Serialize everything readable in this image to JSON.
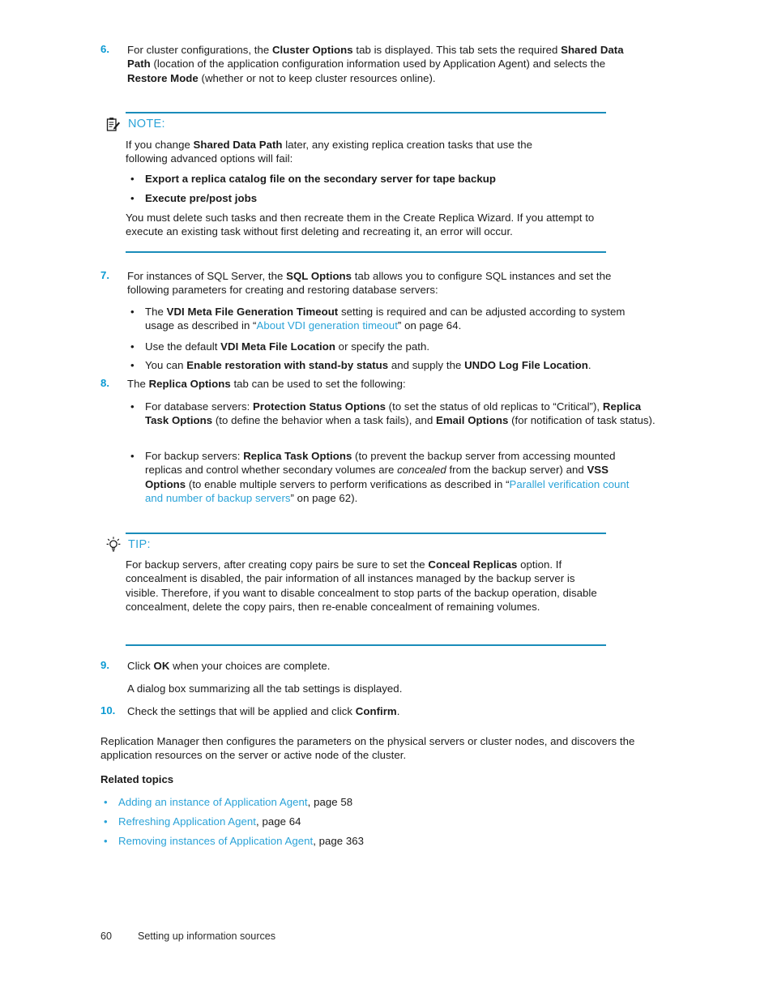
{
  "document": {
    "page_number": "60",
    "footer_title": "Setting up information sources",
    "accent_color": "#2aa3d8",
    "rule_color": "#1a8cba",
    "number_color": "#0b9ad3",
    "body_color": "#1a1a1a"
  },
  "steps": {
    "s6": {
      "number": "6.",
      "parts": [
        {
          "t": "For cluster configurations, the ",
          "s": "n"
        },
        {
          "t": "Cluster Options",
          "s": "b"
        },
        {
          "t": " tab is displayed. This tab sets the required ",
          "s": "n"
        },
        {
          "t": "Shared Data Path",
          "s": "b"
        },
        {
          "t": " (location of the application configuration information used by Application Agent) and selects the ",
          "s": "n"
        },
        {
          "t": "Restore Mode",
          "s": "b"
        },
        {
          "t": " (whether or not to keep cluster resources online).",
          "s": "n"
        }
      ]
    },
    "s7": {
      "number": "7.",
      "parts": [
        {
          "t": "For instances of SQL Server, the ",
          "s": "n"
        },
        {
          "t": "SQL Options",
          "s": "b"
        },
        {
          "t": " tab allows you to configure SQL instances and set the following parameters for creating and restoring database servers:",
          "s": "n"
        }
      ],
      "bullets": [
        {
          "parts": [
            {
              "t": "The ",
              "s": "n"
            },
            {
              "t": "VDI Meta File Generation Timeout",
              "s": "b"
            },
            {
              "t": " setting is required and can be adjusted according to system usage as described in “",
              "s": "n"
            },
            {
              "t": "About VDI generation timeout",
              "s": "l"
            },
            {
              "t": "” on page 64.",
              "s": "n"
            }
          ]
        },
        {
          "parts": [
            {
              "t": "Use the default ",
              "s": "n"
            },
            {
              "t": "VDI Meta File Location",
              "s": "b"
            },
            {
              "t": " or specify the path.",
              "s": "n"
            }
          ]
        },
        {
          "parts": [
            {
              "t": "You can ",
              "s": "n"
            },
            {
              "t": "Enable restoration with stand-by status",
              "s": "b"
            },
            {
              "t": " and supply the ",
              "s": "n"
            },
            {
              "t": "UNDO Log File Location",
              "s": "b"
            },
            {
              "t": ".",
              "s": "n"
            }
          ]
        }
      ]
    },
    "s8": {
      "number": "8.",
      "parts": [
        {
          "t": "The ",
          "s": "n"
        },
        {
          "t": "Replica Options",
          "s": "b"
        },
        {
          "t": " tab can be used to set the following:",
          "s": "n"
        }
      ],
      "bullets": [
        {
          "parts": [
            {
              "t": "For database servers: ",
              "s": "n"
            },
            {
              "t": "Protection Status Options",
              "s": "b"
            },
            {
              "t": " (to set the status of old replicas to “Critical”), ",
              "s": "n"
            },
            {
              "t": "Replica Task Options",
              "s": "b"
            },
            {
              "t": " (to define the behavior when a task fails), and ",
              "s": "n"
            },
            {
              "t": "Email Options",
              "s": "b"
            },
            {
              "t": " (for notification of task status).",
              "s": "n"
            }
          ]
        },
        {
          "parts": [
            {
              "t": "For backup servers: ",
              "s": "n"
            },
            {
              "t": "Replica Task Options",
              "s": "b"
            },
            {
              "t": " (to prevent the backup server from accessing mounted replicas and control whether secondary volumes are ",
              "s": "n"
            },
            {
              "t": "concealed",
              "s": "i"
            },
            {
              "t": " from the backup server) and ",
              "s": "n"
            },
            {
              "t": "VSS Options",
              "s": "b"
            },
            {
              "t": " (to enable multiple servers to perform verifications as described in “",
              "s": "n"
            },
            {
              "t": "Parallel verification count and number of backup servers",
              "s": "l"
            },
            {
              "t": "” on page 62).",
              "s": "n"
            }
          ]
        }
      ]
    },
    "s9": {
      "number": "9.",
      "parts": [
        {
          "t": "Click ",
          "s": "n"
        },
        {
          "t": "OK",
          "s": "b"
        },
        {
          "t": " when your choices are complete.",
          "s": "n"
        }
      ],
      "continuation": "A dialog box summarizing all the tab settings is displayed."
    },
    "s10": {
      "number": "10.",
      "parts": [
        {
          "t": "Check the settings that will be applied and click ",
          "s": "n"
        },
        {
          "t": "Confirm",
          "s": "b"
        },
        {
          "t": ".",
          "s": "n"
        }
      ]
    }
  },
  "note": {
    "icon": "note-clipboard-icon",
    "label": "NOTE:",
    "intro_parts": [
      {
        "t": "If you change ",
        "s": "n"
      },
      {
        "t": "Shared Data Path",
        "s": "b"
      },
      {
        "t": " later, any existing replica creation tasks that use the following advanced options will fail:",
        "s": "n"
      }
    ],
    "bullets": [
      "Export a replica catalog file on the secondary server for tape backup",
      "Execute pre/post jobs"
    ],
    "outro": "You must delete such tasks and then recreate them in the Create Replica Wizard. If you attempt to execute an existing task without first deleting and recreating it, an error will occur."
  },
  "tip": {
    "icon": "tip-lightbulb-icon",
    "label": "TIP:",
    "parts": [
      {
        "t": "For backup servers, after creating copy pairs be sure to set the ",
        "s": "n"
      },
      {
        "t": "Conceal Replicas",
        "s": "b"
      },
      {
        "t": " option. If concealment is disabled, the pair information of all instances managed by the backup server is visible. Therefore, if you want to disable concealment to stop parts of the backup operation, disable concealment, delete the copy pairs, then re-enable concealment of remaining volumes.",
        "s": "n"
      }
    ]
  },
  "closing_paragraph": "Replication Manager then configures the parameters on the physical servers or cluster nodes, and discovers the application resources on the server or active node of the cluster.",
  "related": {
    "heading": "Related topics",
    "items": [
      {
        "link": "Adding an instance of Application Agent",
        "suffix": ", page 58"
      },
      {
        "link": "Refreshing Application Agent",
        "suffix": ", page 64"
      },
      {
        "link": "Removing instances of Application Agent",
        "suffix": ", page 363"
      }
    ]
  }
}
